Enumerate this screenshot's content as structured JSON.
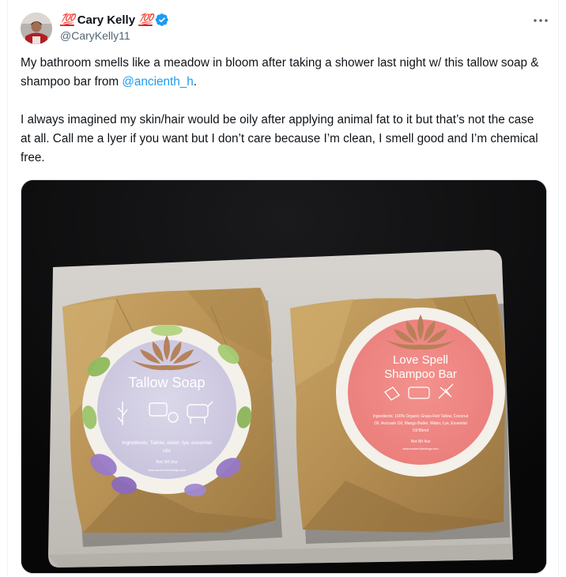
{
  "author": {
    "display_name": "Cary Kelly",
    "handle": "@CaryKelly11",
    "emoji_left": "💯",
    "emoji_right": "💯",
    "verified": true
  },
  "icons": {
    "verified": "verified-badge-icon",
    "more": "more-horizontal-icon"
  },
  "tweet": {
    "p1_before": "My bathroom smells like a meadow in bloom after taking a shower last night w/ this tallow soap & shampoo bar from ",
    "p1_mention": "@ancienth_h",
    "p1_after": ".",
    "p2": "I always imagined my skin/hair would be oily after applying animal fat to it but that’s not the case at all. Call me a lyer if you want but I don’t care because I’m clean, I smell good and I’m chemical free."
  },
  "photo": {
    "left_label": {
      "title": "Tallow Soap",
      "ingredients_1": "Ingredients: Tallow, water, lye, essential",
      "ingredients_2": "oils",
      "net_wt": "Net Wt 2oz",
      "site": "www.ancient-feedings.com"
    },
    "right_label": {
      "title_1": "Love Spell",
      "title_2": "Shampoo Bar",
      "ingredients_1": "Ingredients: 100% Organic Grass-Fed Tallow, Coconut",
      "ingredients_2": "Oil, Avocado Oil, Mango Butter, Water, Lye, Essential",
      "ingredients_3": "Oil Blend",
      "net_wt": "Net Wt 4oz",
      "site": "www.ancient-feedings.com"
    }
  },
  "colors": {
    "accent": "#1d9bf0",
    "text": "#0f1419",
    "muted": "#536471",
    "emoji_red": "#d3212c"
  }
}
